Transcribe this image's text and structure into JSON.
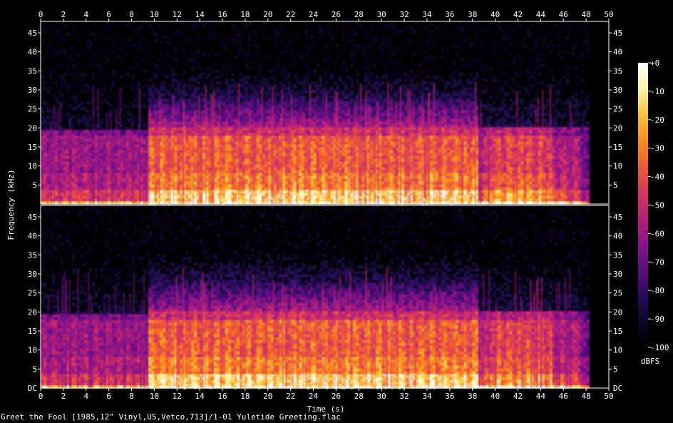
{
  "chart_data": {
    "type": "heatmap",
    "description_units": {
      "x": "Time (s)",
      "y": "Frequency (kHz)",
      "z": "dBFS"
    },
    "xlabel": "Time (s)",
    "ylabel": "Frequency (kHz)",
    "colorbar_label": "dBFS",
    "xlim": [
      0,
      50
    ],
    "ylim": [
      0,
      48
    ],
    "zlim": [
      -100,
      0
    ],
    "x_ticks": [
      0,
      2,
      4,
      6,
      8,
      10,
      12,
      14,
      16,
      18,
      20,
      22,
      24,
      26,
      28,
      30,
      32,
      34,
      36,
      38,
      40,
      42,
      44,
      46,
      48,
      50
    ],
    "y_ticks": [
      5,
      10,
      15,
      20,
      25,
      30,
      35,
      40,
      45
    ],
    "y_tick_bottom_label": "DC",
    "colorbar_ticks": [
      0,
      -10,
      -20,
      -30,
      -40,
      -50,
      -60,
      -70,
      -80,
      -90,
      -100
    ],
    "colorbar_tick_labels": [
      "+0",
      "-10",
      "-20",
      "-30",
      "-40",
      "-50",
      "-60",
      "-70",
      "-80",
      "-90",
      "-100"
    ],
    "channels": 2,
    "colors": {
      "background": "#000000",
      "axes": "#ffffff",
      "colormap": [
        "#000000",
        "#0b0726",
        "#2a0b5e",
        "#5c0f82",
        "#8a1388",
        "#b51f7a",
        "#d9365e",
        "#f05a32",
        "#fb8c1d",
        "#fbc33b",
        "#fcf2a8",
        "#ffffff"
      ]
    }
  },
  "footer": {
    "text": "Greet the Fool [1985,12\" Vinyl,US,Vetco,713]/1-01 Yuletide Greeting.flac"
  }
}
